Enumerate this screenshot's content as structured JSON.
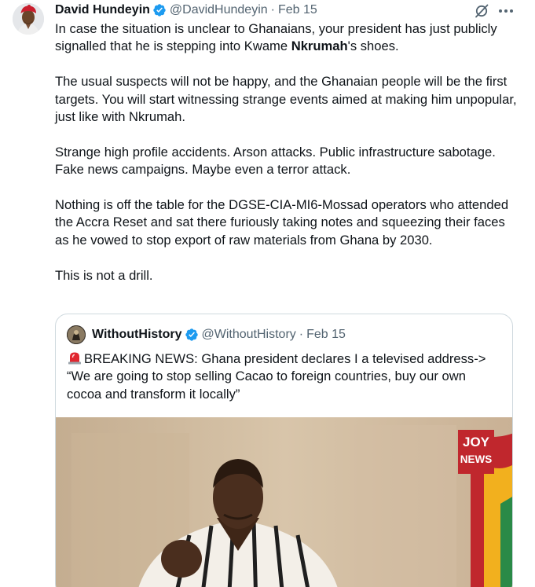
{
  "tweet": {
    "display_name": "David Hundeyin",
    "handle": "@DavidHundeyin",
    "separator": "·",
    "date": "Feb 15",
    "paragraphs": [
      {
        "before": "In case the situation is unclear to Ghanaians, your president has just publicly signalled that he is stepping into Kwame ",
        "bold": "Nkrumah",
        "after": "'s shoes."
      },
      {
        "text": "The usual suspects will not be happy, and the Ghanaian people will be the first targets. You will start witnessing strange events aimed at making him unpopular, just like with Nkrumah."
      },
      {
        "text": "Strange high profile accidents. Arson attacks. Public infrastructure sabotage. Fake news campaigns. Maybe even a terror attack."
      },
      {
        "text": "Nothing is off the table for the DGSE-CIA-MI6-Mossad operators who attended the Accra Reset and sat there furiously taking notes and squeezing their faces as he vowed to stop export of raw materials from Ghana by 2030."
      },
      {
        "text": "This is not a drill."
      }
    ]
  },
  "quote": {
    "display_name": "WithoutHistory",
    "handle": "@WithoutHistory",
    "separator": "·",
    "date": "Feb 15",
    "text": "BREAKING NEWS: Ghana president declares I a televised address-> “We are going to stop selling Cacao to foreign countries, buy our own cocoa and transform it locally”",
    "media": {
      "logo_top": "JOY",
      "logo_bottom": "NEWS"
    }
  },
  "icons": {
    "verified": "verified-badge-icon",
    "grok": "grok-icon",
    "more": "more-icon",
    "siren": "police-light-icon"
  },
  "colors": {
    "text": "#0f1419",
    "secondary": "#536471",
    "verified": "#1d9bf0",
    "border": "#cfd9de"
  }
}
